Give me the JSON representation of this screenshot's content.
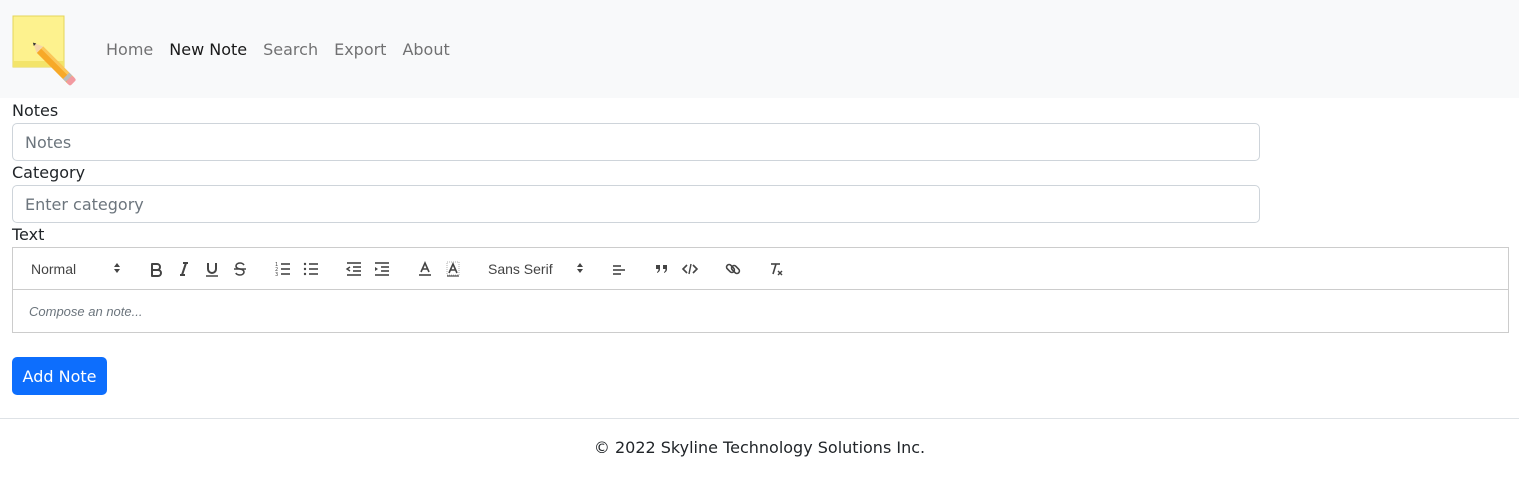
{
  "nav": {
    "items": [
      {
        "label": "Home"
      },
      {
        "label": "New Note"
      },
      {
        "label": "Search"
      },
      {
        "label": "Export"
      },
      {
        "label": "About"
      }
    ],
    "active_index": 1
  },
  "form": {
    "notes_label": "Notes",
    "notes_placeholder": "Notes",
    "category_label": "Category",
    "category_placeholder": "Enter category",
    "text_label": "Text"
  },
  "editor": {
    "header_select": "Normal",
    "font_select": "Sans Serif",
    "placeholder": "Compose an note..."
  },
  "submit_label": "Add Note",
  "footer": {
    "copyright": "© 2022 Skyline Technology Solutions Inc."
  },
  "colors": {
    "primary": "#0d6efd",
    "navbar_bg": "#f8f9fa",
    "border": "#ced4da"
  }
}
